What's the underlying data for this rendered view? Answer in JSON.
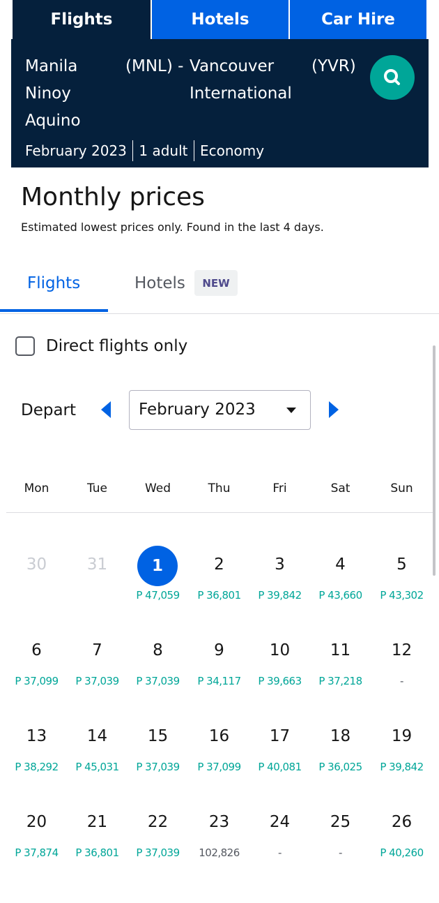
{
  "top_tabs": [
    "Flights",
    "Hotels",
    "Car Hire"
  ],
  "search": {
    "origin": "Manila Ninoy Aquino",
    "origin_code": "(MNL) -",
    "destination": "Vancouver International",
    "destination_code": "(YVR)",
    "date": "February 2023",
    "travellers": "1 adult",
    "cabin": "Economy",
    "button_icon": "search-icon"
  },
  "heading": "Monthly prices",
  "subheading": "Estimated lowest prices only. Found in the last 4 days.",
  "content_tabs": {
    "flights": "Flights",
    "hotels": "Hotels",
    "badge": "NEW"
  },
  "direct_only_label": "Direct flights only",
  "depart_label": "Depart",
  "month_select": "February 2023",
  "weekdays": [
    "Mon",
    "Tue",
    "Wed",
    "Thu",
    "Fri",
    "Sat",
    "Sun"
  ],
  "calendar": [
    [
      {
        "day": "30",
        "price": "",
        "muted": true
      },
      {
        "day": "31",
        "price": "",
        "muted": true
      },
      {
        "day": "1",
        "price": "P 47,059",
        "selected": true
      },
      {
        "day": "2",
        "price": "P 36,801"
      },
      {
        "day": "3",
        "price": "P 39,842"
      },
      {
        "day": "4",
        "price": "P 43,660"
      },
      {
        "day": "5",
        "price": "P 43,302"
      }
    ],
    [
      {
        "day": "6",
        "price": "P 37,099"
      },
      {
        "day": "7",
        "price": "P 37,039"
      },
      {
        "day": "8",
        "price": "P 37,039"
      },
      {
        "day": "9",
        "price": "P 34,117"
      },
      {
        "day": "10",
        "price": "P 39,663"
      },
      {
        "day": "11",
        "price": "P 37,218"
      },
      {
        "day": "12",
        "price": "-",
        "grey": true
      }
    ],
    [
      {
        "day": "13",
        "price": "P 38,292"
      },
      {
        "day": "14",
        "price": "P 45,031"
      },
      {
        "day": "15",
        "price": "P 37,039"
      },
      {
        "day": "16",
        "price": "P 37,099"
      },
      {
        "day": "17",
        "price": "P 40,081"
      },
      {
        "day": "18",
        "price": "P 36,025"
      },
      {
        "day": "19",
        "price": "P 39,842"
      }
    ],
    [
      {
        "day": "20",
        "price": "P 37,874"
      },
      {
        "day": "21",
        "price": "P 36,801"
      },
      {
        "day": "22",
        "price": "P 37,039"
      },
      {
        "day": "23",
        "price": "102,826",
        "grey": true
      },
      {
        "day": "24",
        "price": "-",
        "grey": true
      },
      {
        "day": "25",
        "price": "-",
        "grey": true
      },
      {
        "day": "26",
        "price": "P 40,260"
      }
    ]
  ],
  "colors": {
    "navy": "#05203c",
    "blue": "#0062e3",
    "teal": "#00a698"
  }
}
